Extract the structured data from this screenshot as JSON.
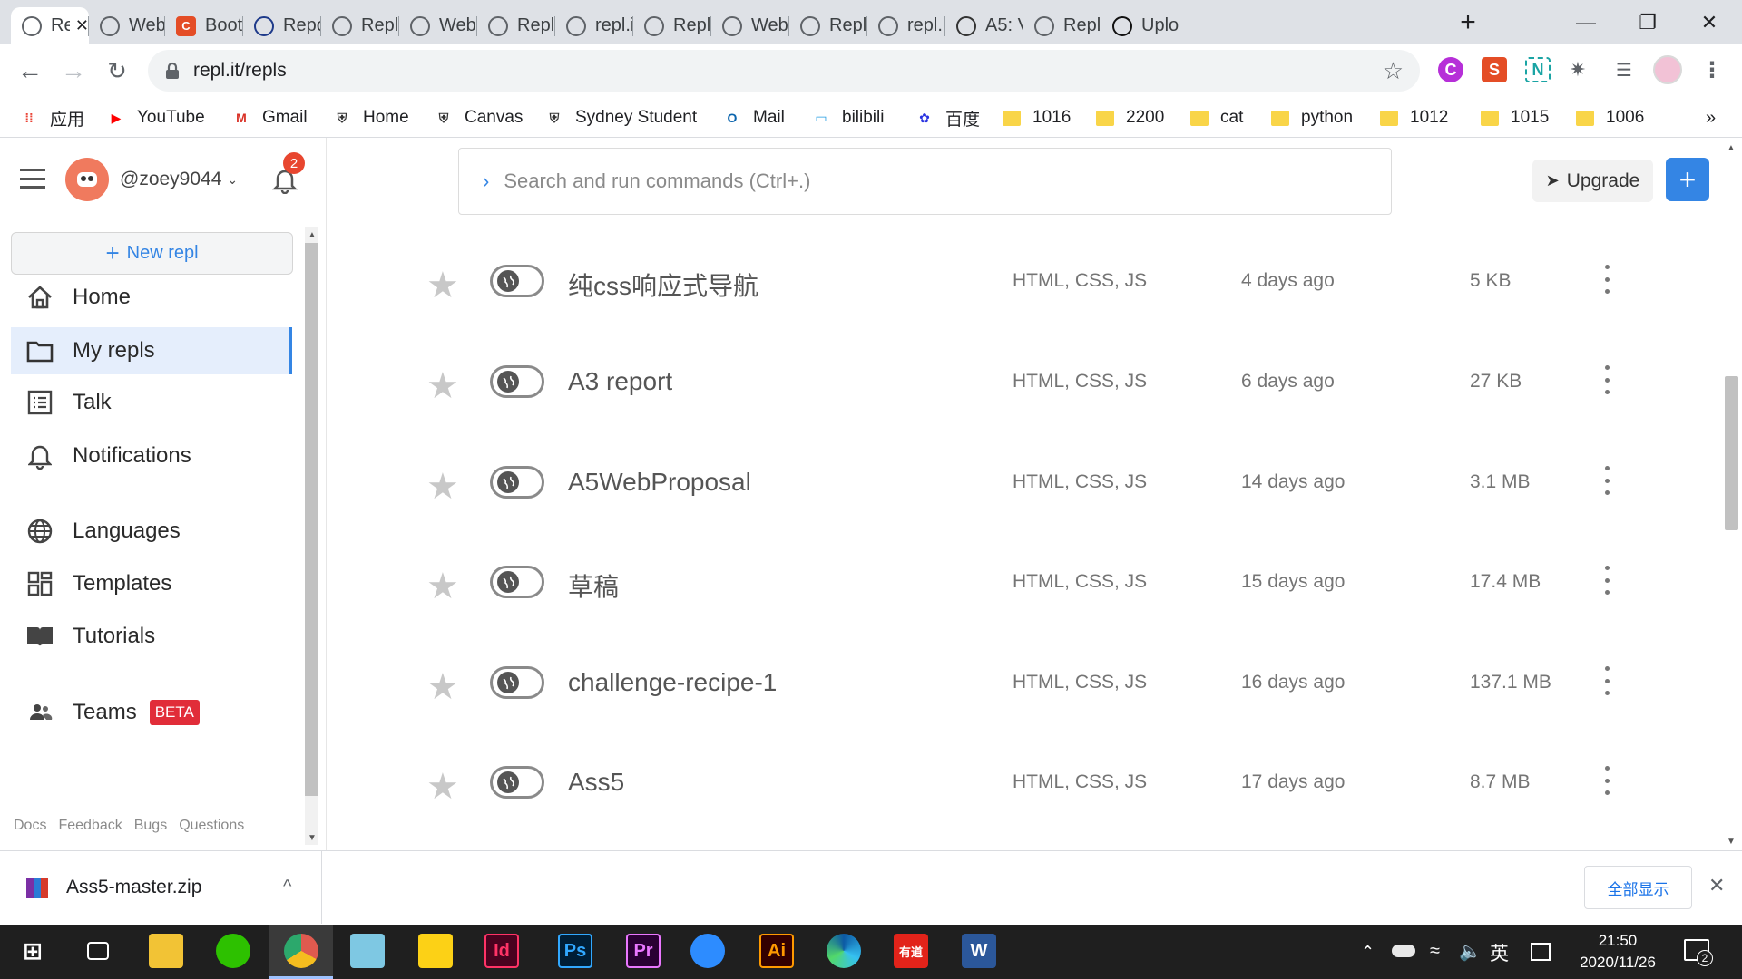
{
  "browser": {
    "tabs": [
      {
        "title": "Re",
        "favicon": "replit-icon",
        "active": true
      },
      {
        "title": "Web",
        "favicon": "globe-icon"
      },
      {
        "title": "Boot",
        "favicon": "c-logo-icon"
      },
      {
        "title": "Repo",
        "favicon": "horse-icon"
      },
      {
        "title": "Repl.",
        "favicon": "replit-icon"
      },
      {
        "title": "Web",
        "favicon": "globe-icon"
      },
      {
        "title": "Repl.",
        "favicon": "replit-icon"
      },
      {
        "title": "repl.i",
        "favicon": "globe-icon"
      },
      {
        "title": "Repl.",
        "favicon": "replit-icon"
      },
      {
        "title": "Web",
        "favicon": "globe-icon"
      },
      {
        "title": "Repl.",
        "favicon": "replit-icon"
      },
      {
        "title": "repl.i",
        "favicon": "globe-icon"
      },
      {
        "title": "A5: V",
        "favicon": "shield-crest-icon"
      },
      {
        "title": "Repl.",
        "favicon": "replit-icon"
      },
      {
        "title": "Uplo",
        "favicon": "github-icon"
      }
    ],
    "new_tab": "+",
    "url": "repl.it/repls",
    "bookmarks": [
      {
        "label": "应用",
        "icon": "apps-grid-icon"
      },
      {
        "label": "YouTube",
        "icon": "youtube-icon"
      },
      {
        "label": "Gmail",
        "icon": "gmail-icon"
      },
      {
        "label": "Home",
        "icon": "crest-icon"
      },
      {
        "label": "Canvas",
        "icon": "crest-icon"
      },
      {
        "label": "Sydney Student",
        "icon": "crest-icon"
      },
      {
        "label": "Mail",
        "icon": "outlook-icon"
      },
      {
        "label": "bilibili",
        "icon": "bilibili-icon"
      },
      {
        "label": "百度",
        "icon": "baidu-paw-icon"
      },
      {
        "label": "1016",
        "icon": "folder-icon"
      },
      {
        "label": "2200",
        "icon": "folder-icon"
      },
      {
        "label": "cat",
        "icon": "folder-icon"
      },
      {
        "label": "python",
        "icon": "folder-icon"
      },
      {
        "label": "1012",
        "icon": "folder-icon"
      },
      {
        "label": "1015",
        "icon": "folder-icon"
      },
      {
        "label": "1006",
        "icon": "folder-icon"
      }
    ],
    "bookmarks_more": "»",
    "extensions": [
      {
        "name": "c-extension-icon",
        "glyph": "C",
        "color": "#b62fd8"
      },
      {
        "name": "s-extension-icon",
        "glyph": "S",
        "color": "#e44d26"
      },
      {
        "name": "n-extension-icon",
        "glyph": "N",
        "color": "#1aa4a4"
      }
    ]
  },
  "app": {
    "username": "@zoey9044",
    "notification_count": "2",
    "new_repl": "New repl",
    "new_repl_plus": "+",
    "search_placeholder": "Search and run commands (Ctrl+.)",
    "search_chevron": "›",
    "upgrade": "Upgrade",
    "plus": "+",
    "nav": [
      {
        "label": "Home",
        "icon": "home-icon"
      },
      {
        "label": "My repls",
        "icon": "folder-icon",
        "selected": true
      },
      {
        "label": "Talk",
        "icon": "talk-list-icon"
      },
      {
        "label": "Notifications",
        "icon": "bell-icon"
      },
      {
        "label": "Languages",
        "icon": "globe-icon"
      },
      {
        "label": "Templates",
        "icon": "templates-grid-icon"
      },
      {
        "label": "Tutorials",
        "icon": "book-icon"
      },
      {
        "label": "Teams",
        "icon": "people-icon",
        "badge": "BETA"
      }
    ],
    "footer_links": [
      "Docs",
      "Feedback",
      "Bugs",
      "Questions"
    ],
    "repls": [
      {
        "title": "纯css响应式导航",
        "lang": "HTML, CSS, JS",
        "date": "4 days ago",
        "size": "5 KB"
      },
      {
        "title": "A3 report",
        "lang": "HTML, CSS, JS",
        "date": "6 days ago",
        "size": "27 KB"
      },
      {
        "title": "A5WebProposal",
        "lang": "HTML, CSS, JS",
        "date": "14 days ago",
        "size": "3.1 MB"
      },
      {
        "title": "草稿",
        "lang": "HTML, CSS, JS",
        "date": "15 days ago",
        "size": "17.4 MB"
      },
      {
        "title": "challenge-recipe-1",
        "lang": "HTML, CSS, JS",
        "date": "16 days ago",
        "size": "137.1 MB"
      },
      {
        "title": "Ass5",
        "lang": "HTML, CSS, JS",
        "date": "17 days ago",
        "size": "8.7 MB"
      }
    ]
  },
  "download": {
    "filename": "Ass5-master.zip",
    "show_all": "全部显示",
    "close": "✕",
    "chevron": "^"
  },
  "taskbar": {
    "time": "21:50",
    "date": "2020/11/26",
    "ime": "英",
    "notification_count": "2",
    "apps": [
      {
        "name": "start-windows-icon"
      },
      {
        "name": "task-view-icon"
      },
      {
        "name": "file-explorer-icon"
      },
      {
        "name": "wechat-icon"
      },
      {
        "name": "chrome-icon"
      },
      {
        "name": "notepad-icon"
      },
      {
        "name": "sticky-notes-icon"
      },
      {
        "name": "indesign-icon",
        "glyph": "Id"
      },
      {
        "name": "photoshop-icon",
        "glyph": "Ps"
      },
      {
        "name": "premiere-icon",
        "glyph": "Pr"
      },
      {
        "name": "zoom-icon"
      },
      {
        "name": "illustrator-icon",
        "glyph": "Ai"
      },
      {
        "name": "edge-icon"
      },
      {
        "name": "youdao-icon",
        "glyph": "有道"
      },
      {
        "name": "word-icon",
        "glyph": "W"
      }
    ]
  },
  "colors": {
    "accent": "#3485e4",
    "notif_badge": "#e8462f",
    "beta_badge": "#e12d39",
    "selected_bg": "#e5eefc"
  }
}
